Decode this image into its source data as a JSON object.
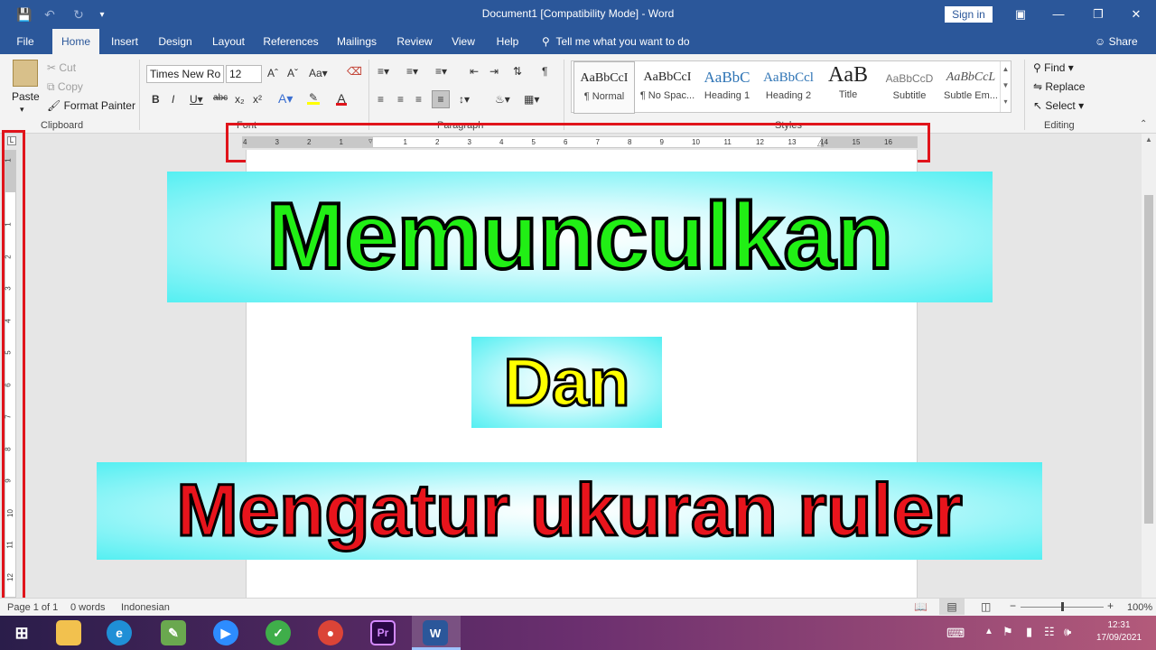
{
  "titlebar": {
    "title": "Document1 [Compatibility Mode]  -  Word",
    "sign_in": "Sign in",
    "icons": [
      "save-icon",
      "undo-icon",
      "redo-icon",
      "customize-icon"
    ],
    "window_buttons": [
      "ribbon-display-icon",
      "minimize-icon",
      "restore-icon",
      "close-icon"
    ]
  },
  "tabs": {
    "items": [
      "File",
      "Home",
      "Insert",
      "Design",
      "Layout",
      "References",
      "Mailings",
      "Review",
      "View",
      "Help"
    ],
    "active": "Home",
    "tell_me": "Tell me what you want to do",
    "share": "Share"
  },
  "ribbon": {
    "clipboard": {
      "paste": "Paste",
      "cut": "Cut",
      "copy": "Copy",
      "format_painter": "Format Painter",
      "label": "Clipboard"
    },
    "font": {
      "family": "Times New Ro",
      "size": "12",
      "label": "Font"
    },
    "paragraph": {
      "label": "Paragraph"
    },
    "styles": {
      "label": "Styles",
      "items": [
        {
          "preview": "AaBbCcI",
          "name": "¶ Normal"
        },
        {
          "preview": "AaBbCcI",
          "name": "¶ No Spac..."
        },
        {
          "preview": "AaBbC",
          "name": "Heading 1"
        },
        {
          "preview": "AaBbCcl",
          "name": "Heading 2"
        },
        {
          "preview": "AaB",
          "name": "Title"
        },
        {
          "preview": "AaBbCcD",
          "name": "Subtitle"
        },
        {
          "preview": "AaBbCcL",
          "name": "Subtle Em..."
        }
      ]
    },
    "editing": {
      "find": "Find",
      "replace": "Replace",
      "select": "Select",
      "label": "Editing"
    }
  },
  "ruler": {
    "horizontal_numbers": [
      "4",
      "3",
      "2",
      "1",
      "1",
      "2",
      "3",
      "4",
      "5",
      "6",
      "7",
      "8",
      "9",
      "10",
      "11",
      "12",
      "13",
      "14",
      "15",
      "16"
    ],
    "vertical_numbers": [
      "1",
      "1",
      "2",
      "3",
      "4",
      "5",
      "6",
      "7",
      "8",
      "9",
      "10",
      "11",
      "12"
    ]
  },
  "overlay": {
    "line1": "Memunculkan",
    "line2": "Dan",
    "line3": "Mengatur ukuran ruler"
  },
  "statusbar": {
    "page": "Page 1 of 1",
    "words": "0 words",
    "language": "Indonesian",
    "zoom": "100%"
  },
  "taskbar": {
    "time": "12:31",
    "date": "17/09/2021",
    "apps": [
      "windows-start-icon",
      "file-explorer-icon",
      "edge-icon",
      "paint-icon",
      "zoom-icon",
      "app-icon",
      "chrome-icon",
      "premiere-icon",
      "word-icon"
    ]
  },
  "colors": {
    "word_blue": "#2b579a",
    "highlight_red": "#e0141b",
    "banner_cyan": "#54eff2",
    "text_green": "#21ef15",
    "text_yellow": "#ffff00",
    "text_red": "#e8141c"
  }
}
